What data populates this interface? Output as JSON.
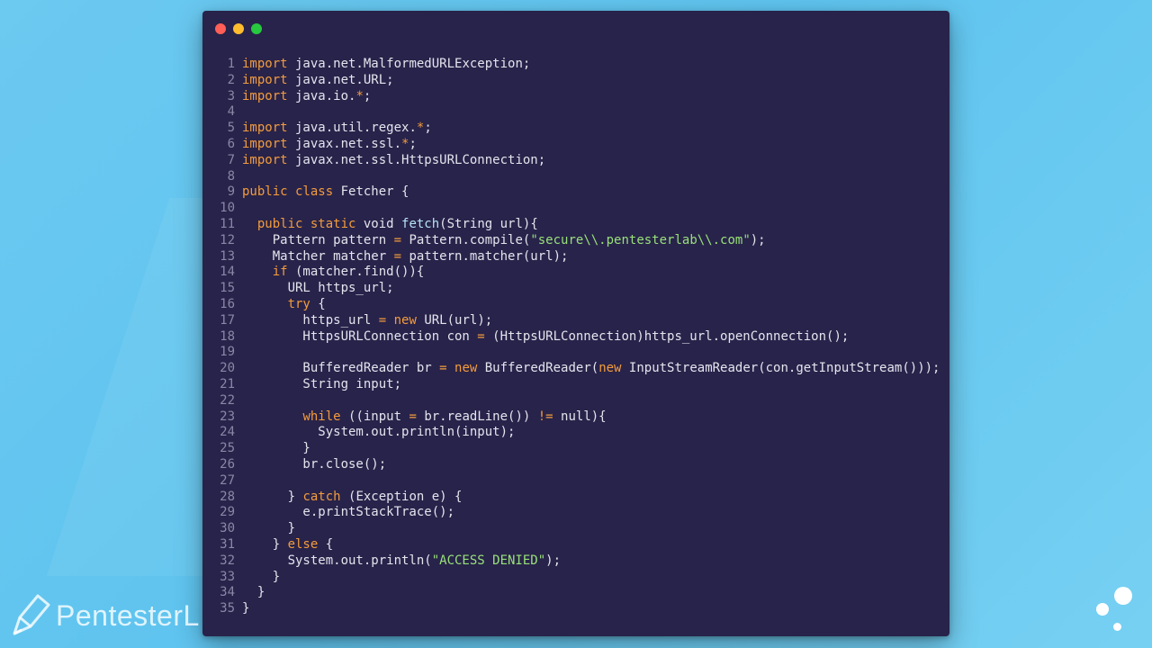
{
  "colors": {
    "background": "#6cc9f0",
    "editor_bg": "#28234a",
    "keyword": "#f39c3d",
    "string": "#98e07a",
    "text": "#e4e4ee",
    "line_number": "#8a87a6"
  },
  "window": {
    "controls": [
      "close",
      "minimize",
      "maximize"
    ]
  },
  "code_lines": [
    {
      "n": "1",
      "html": "<span class=\"kw\">import</span> java.net.MalformedURLException;"
    },
    {
      "n": "2",
      "html": "<span class=\"kw\">import</span> java.net.URL;"
    },
    {
      "n": "3",
      "html": "<span class=\"kw\">import</span> java.io.<span class=\"op\">*</span>;"
    },
    {
      "n": "4",
      "html": ""
    },
    {
      "n": "5",
      "html": "<span class=\"kw\">import</span> java.util.regex.<span class=\"op\">*</span>;"
    },
    {
      "n": "6",
      "html": "<span class=\"kw\">import</span> javax.net.ssl.<span class=\"op\">*</span>;"
    },
    {
      "n": "7",
      "html": "<span class=\"kw\">import</span> javax.net.ssl.HttpsURLConnection;"
    },
    {
      "n": "8",
      "html": ""
    },
    {
      "n": "9",
      "html": "<span class=\"kw\">public class</span> Fetcher {"
    },
    {
      "n": "10",
      "html": ""
    },
    {
      "n": "11",
      "html": "  <span class=\"kw\">public static</span> void <span class=\"fn\">fetch</span>(String url){"
    },
    {
      "n": "12",
      "html": "    Pattern pattern <span class=\"op\">=</span> Pattern.compile(<span class=\"str\">\"secure\\\\.pentesterlab\\\\.com\"</span>);"
    },
    {
      "n": "13",
      "html": "    Matcher matcher <span class=\"op\">=</span> pattern.matcher(url);"
    },
    {
      "n": "14",
      "html": "    <span class=\"kw\">if</span> (matcher.find()){"
    },
    {
      "n": "15",
      "html": "      URL https_url;"
    },
    {
      "n": "16",
      "html": "      <span class=\"kw\">try</span> {"
    },
    {
      "n": "17",
      "html": "        https_url <span class=\"op\">=</span> <span class=\"kw\">new</span> URL(url);"
    },
    {
      "n": "18",
      "html": "        HttpsURLConnection con <span class=\"op\">=</span> (HttpsURLConnection)https_url.openConnection();"
    },
    {
      "n": "19",
      "html": ""
    },
    {
      "n": "20",
      "html": "        BufferedReader br <span class=\"op\">=</span> <span class=\"kw\">new</span> BufferedReader(<span class=\"kw\">new</span> InputStreamReader(con.getInputStream()));"
    },
    {
      "n": "21",
      "html": "        String input;"
    },
    {
      "n": "22",
      "html": ""
    },
    {
      "n": "23",
      "html": "        <span class=\"kw\">while</span> ((input <span class=\"op\">=</span> br.readLine()) <span class=\"op\">!=</span> null){"
    },
    {
      "n": "24",
      "html": "          System.out.println(input);"
    },
    {
      "n": "25",
      "html": "        }"
    },
    {
      "n": "26",
      "html": "        br.close();"
    },
    {
      "n": "27",
      "html": ""
    },
    {
      "n": "28",
      "html": "      } <span class=\"kw\">catch</span> (Exception e) {"
    },
    {
      "n": "29",
      "html": "        e.printStackTrace();"
    },
    {
      "n": "30",
      "html": "      }"
    },
    {
      "n": "31",
      "html": "    } <span class=\"kw\">else</span> {"
    },
    {
      "n": "32",
      "html": "      System.out.println(<span class=\"str\">\"ACCESS DENIED\"</span>);"
    },
    {
      "n": "33",
      "html": "    }"
    },
    {
      "n": "34",
      "html": "  }"
    },
    {
      "n": "35",
      "html": "}"
    }
  ],
  "branding": {
    "logo_text": "PentesterL",
    "logo_icon": "pen-icon"
  }
}
